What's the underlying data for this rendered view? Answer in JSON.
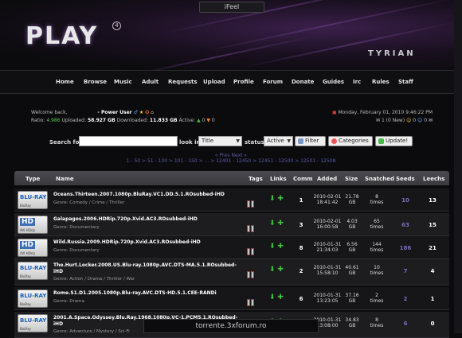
{
  "top_box_label": "iFeel",
  "logo_text": "PLAY",
  "logo_number": "4",
  "skin_name": "TYRIAN",
  "nav": [
    "Home",
    "Browse",
    "Music",
    "Adult",
    "Requests",
    "Upload",
    "Profile",
    "Forum",
    "Donate",
    "Guides",
    "Irc",
    "Rules",
    "Staff"
  ],
  "user": {
    "welcome": "Welcome back,",
    "class": "- Power User",
    "ratio_label": "Ratio:",
    "ratio": "4.986",
    "uploaded_label": "Uploaded:",
    "uploaded": "58.927 GB",
    "downloaded_label": "Downloaded:",
    "downloaded": "11.833 GB",
    "active_label": "Active:",
    "active_up": "0",
    "active_down": "0",
    "date": "Monday, February 01, 2010 9:46:22 PM",
    "messages": "1 (0 New)",
    "bonus": "0",
    "invites": "0"
  },
  "search": {
    "search_for_label": "Search for",
    "look_in_label": "look in",
    "look_in_value": "Title",
    "status_label": "status",
    "status_value": "Active",
    "filter_label": "Filter",
    "categories_label": "Categories",
    "update_label": "Update!"
  },
  "pager": {
    "prev_next": "« Prev      Next »",
    "pages": "1 - 50 > 51 - 100 > 101 - 150 > ... > 12401 - 12450 > 12451 - 12500 > 12501 - 12508"
  },
  "table": {
    "columns": [
      "Type",
      "Name",
      "Tags",
      "Links",
      "Comm",
      "Added",
      "Size",
      "Snatched",
      "Seeds",
      "Leechs"
    ],
    "rows": [
      {
        "format": "BLU-RAY",
        "format_sub": "BluRay",
        "name": "Oceans.Thirteen.2007.1080p.BluRay.VC1.DD.5.1.ROsubbed-iHD",
        "genre": "Genre: Comedy / Crime / Thriller",
        "comm": "1",
        "added_date": "2010-02-01",
        "added_time": "18:41:42",
        "size_num": "21.78",
        "size_unit": "GB",
        "snatched": "8",
        "snatched_unit": "times",
        "seeds": "10",
        "leechs": "13"
      },
      {
        "format": "HD",
        "format_sub": "AVI HDrip",
        "name": "Galapagos.2006.HDRip.720p.Xvid.AC3.ROsubbed-iHD",
        "genre": "Genre: Documentary",
        "comm": "3",
        "added_date": "2010-02-01",
        "added_time": "16:00:58",
        "size_num": "4.03",
        "size_unit": "GB",
        "snatched": "65",
        "snatched_unit": "times",
        "seeds": "63",
        "leechs": "15"
      },
      {
        "format": "HD",
        "format_sub": "AVI HDrip",
        "name": "Wild.Russia.2009.HDRip.720p.Xvid.AC3.ROsubbed-iHD",
        "genre": "Genre: Documentary",
        "comm": "8",
        "added_date": "2010-01-31",
        "added_time": "21:34:03",
        "size_num": "6.56",
        "size_unit": "GB",
        "snatched": "144",
        "snatched_unit": "times",
        "seeds": "186",
        "leechs": "21"
      },
      {
        "format": "BLU-RAY",
        "format_sub": "BluRay",
        "name": "The.Hurt.Locker.2008.US.Blu-ray.1080p.AVC.DTS-MA.5.1.ROsubbed-iHD",
        "genre": "Genre: Action / Drama / Thriller / War",
        "comm": "2",
        "added_date": "2010-01-31",
        "added_time": "15:58:10",
        "size_num": "40.61",
        "size_unit": "GB",
        "snatched": "10",
        "snatched_unit": "times",
        "seeds": "7",
        "leechs": "4"
      },
      {
        "format": "BLU-RAY",
        "format_sub": "BluRay",
        "name": "Rome.S1.D1.2005.1080p.Blu-ray.AVC.DTS-HD.5.1.CEE-RANDi",
        "genre": "Genre: Drama",
        "comm": "6",
        "added_date": "2010-01-31",
        "added_time": "13:23:05",
        "size_num": "37.16",
        "size_unit": "GB",
        "snatched": "2",
        "snatched_unit": "times",
        "seeds": "2",
        "leechs": "1"
      },
      {
        "format": "BLU-RAY",
        "format_sub": "BluRay",
        "name": "2001.A.Space.Odyssey.Blu.Ray.1968.1080p.VC-1.PCM5.1.ROsubbed-iHD",
        "genre": "Genre: Adventure / Mystery / Sci-Fi",
        "comm": "3",
        "added_date": "2010-01-31",
        "added_time": "13:08:00",
        "size_num": "34.83",
        "size_unit": "GB",
        "snatched": "8",
        "snatched_unit": "times",
        "seeds": "6",
        "leechs": "0"
      }
    ]
  },
  "footer_url": "torrente.3xforum.ro"
}
